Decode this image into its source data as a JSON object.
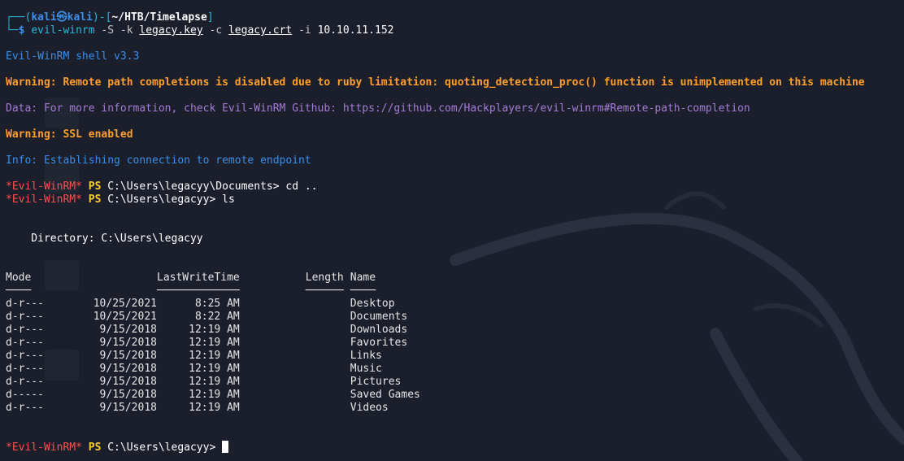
{
  "prompt": {
    "frame_top": "┌──(",
    "user": "kali㉿kali",
    "frame_mid": ")-[",
    "path": "~/HTB/Timelapse",
    "frame_end": "]",
    "frame_bottom": "└─",
    "dollar": "$ "
  },
  "command": {
    "bin": "evil-winrm",
    "flag_s": " -S",
    "flag_k": " -k ",
    "key": "legacy.key",
    "flag_c": " -c ",
    "crt": "legacy.crt",
    "flag_i": " -i ",
    "ip": "10.10.11.152"
  },
  "output": {
    "version": "Evil-WinRM shell v3.3",
    "warning1": "Warning: Remote path completions is disabled due to ruby limitation: quoting_detection_proc() function is unimplemented on this machine",
    "data_info": "Data: For more information, check Evil-WinRM Github: https://github.com/Hackplayers/evil-winrm#Remote-path-completion",
    "warning2": "Warning: SSL enabled",
    "info": "Info: Establishing connection to remote endpoint"
  },
  "ps": {
    "label": "*Evil-WinRM*",
    "ps": " PS ",
    "cmd1_path": "C:\\Users\\legacyy\\Documents> ",
    "cmd1": "cd ..",
    "cmd2_path": "C:\\Users\\legacyy> ",
    "cmd2": "ls",
    "final_path": "C:\\Users\\legacyy> "
  },
  "listing": {
    "directory_line": "    Directory: C:\\Users\\legacyy",
    "headers": {
      "mode": "Mode",
      "lastwrite": "LastWriteTime",
      "length": "Length",
      "name": "Name"
    },
    "underlines": {
      "mode": "────",
      "lastwrite": "─────────────",
      "length": "──────",
      "name": "────"
    },
    "rows": [
      {
        "mode": "d-r---",
        "date": "10/25/2021",
        "time": "8:25 AM",
        "length": "",
        "name": "Desktop"
      },
      {
        "mode": "d-r---",
        "date": "10/25/2021",
        "time": "8:22 AM",
        "length": "",
        "name": "Documents"
      },
      {
        "mode": "d-r---",
        "date": "9/15/2018",
        "time": "12:19 AM",
        "length": "",
        "name": "Downloads"
      },
      {
        "mode": "d-r---",
        "date": "9/15/2018",
        "time": "12:19 AM",
        "length": "",
        "name": "Favorites"
      },
      {
        "mode": "d-r---",
        "date": "9/15/2018",
        "time": "12:19 AM",
        "length": "",
        "name": "Links"
      },
      {
        "mode": "d-r---",
        "date": "9/15/2018",
        "time": "12:19 AM",
        "length": "",
        "name": "Music"
      },
      {
        "mode": "d-r---",
        "date": "9/15/2018",
        "time": "12:19 AM",
        "length": "",
        "name": "Pictures"
      },
      {
        "mode": "d-----",
        "date": "9/15/2018",
        "time": "12:19 AM",
        "length": "",
        "name": "Saved Games"
      },
      {
        "mode": "d-r---",
        "date": "9/15/2018",
        "time": "12:19 AM",
        "length": "",
        "name": "Videos"
      }
    ]
  },
  "colors": {
    "background": "#1b1f2b",
    "prompt_blue": "#3b8eea",
    "warning_orange": "#ff9e2c",
    "evil_red": "#ff4f4f",
    "ps_yellow": "#ffcc33"
  }
}
